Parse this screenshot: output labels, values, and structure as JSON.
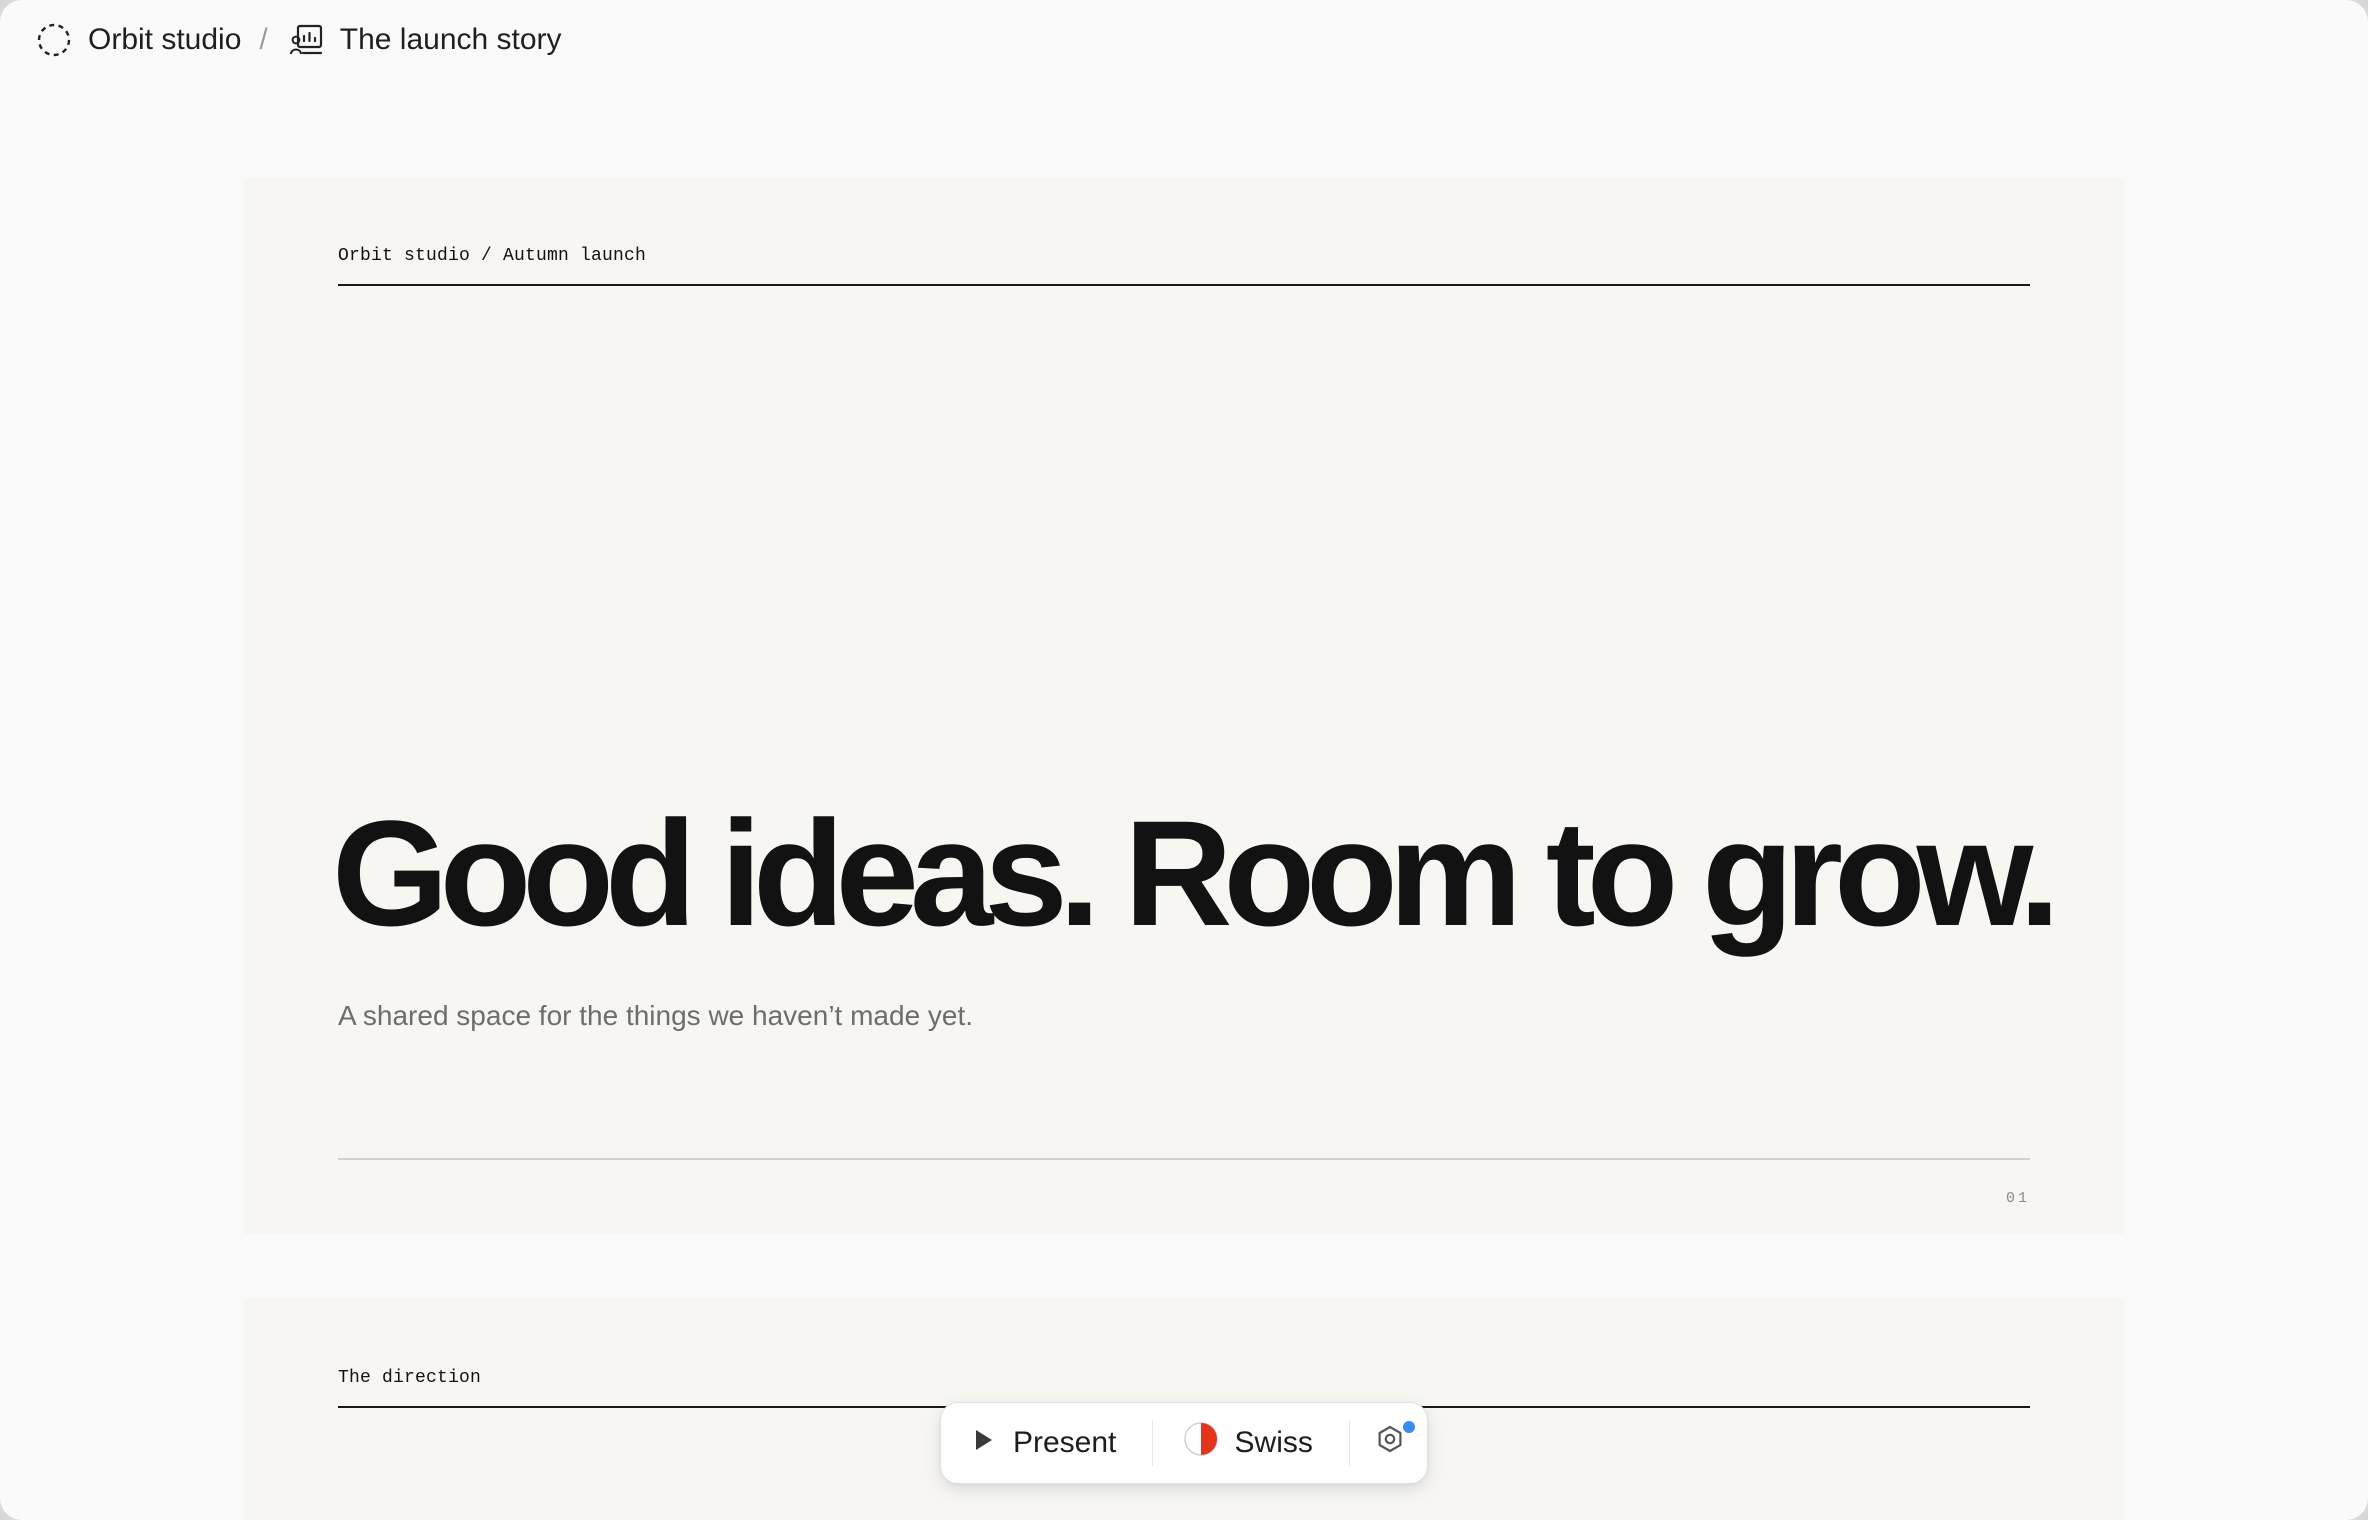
{
  "breadcrumb": {
    "workspace": {
      "label": "Orbit studio",
      "icon": "dashed-circle-icon"
    },
    "separator": "/",
    "document": {
      "label": "The launch story",
      "icon": "presentation-icon"
    }
  },
  "slides": [
    {
      "kicker": "Orbit studio / Autumn launch",
      "headline": "Good ideas. Room to grow.",
      "subline": "A shared space for the things we haven’t made yet.",
      "page_number": "01"
    },
    {
      "kicker": "The direction"
    }
  ],
  "toolbar": {
    "present_label": "Present",
    "present_icon": "play-icon",
    "theme_label": "Swiss",
    "theme_icon": "half-circle-theme-icon",
    "theme_colors": {
      "left": "#ffffff",
      "right": "#e5341c"
    },
    "settings_icon": "settings-hexagon-icon",
    "notification_color": "#3b8cf0"
  }
}
